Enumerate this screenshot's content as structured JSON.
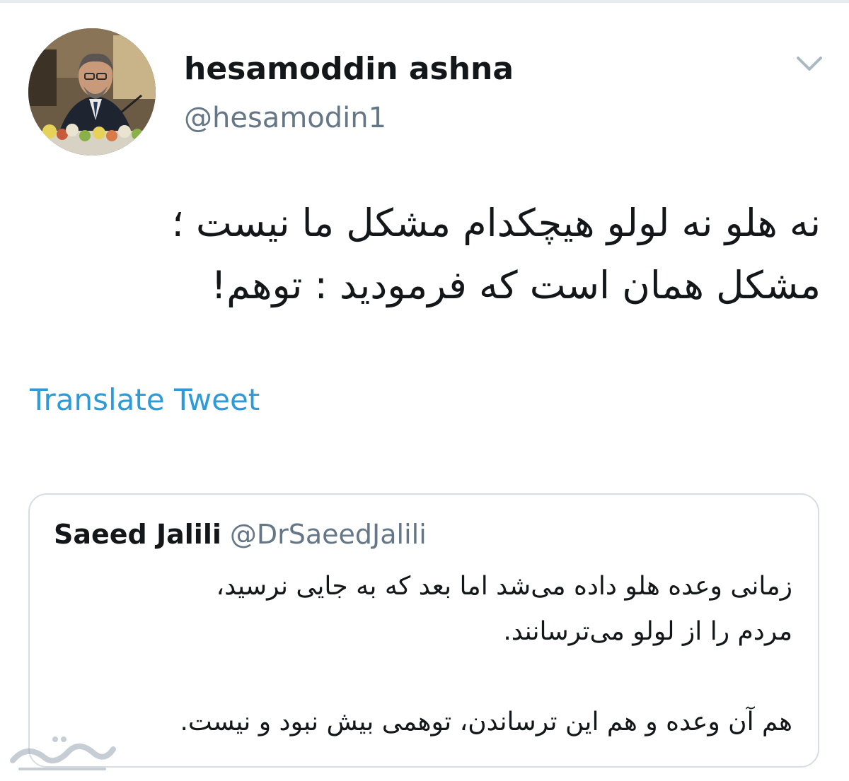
{
  "tweet": {
    "author": {
      "display_name": "hesamoddin ashna",
      "handle": "@hesamodin1"
    },
    "text_lines": [
      "نه هلو نه لولو هیچکدام مشکل ما نیست ؛",
      "مشکل همان است که فرمودید : توهم!"
    ],
    "translate_label": "Translate Tweet",
    "menu_icon": "chevron-down-icon"
  },
  "quoted_tweet": {
    "author_name": "Saeed Jalili",
    "author_handle": "@DrSaeedJalili",
    "paragraph1_lines": [
      "زمانی وعده هلو داده می‌شد اما بعد که به جایی نرسید،",
      "مردم را از لولو می‌ترسانند."
    ],
    "paragraph2_lines": [
      "هم آن وعده و هم این ترساندن، توهمی بیش نبود و نیست."
    ]
  },
  "colors": {
    "link_blue": "#2f9ad8",
    "secondary_gray": "#657786",
    "border_gray": "#d7dde2",
    "text_dark": "#14171a"
  }
}
